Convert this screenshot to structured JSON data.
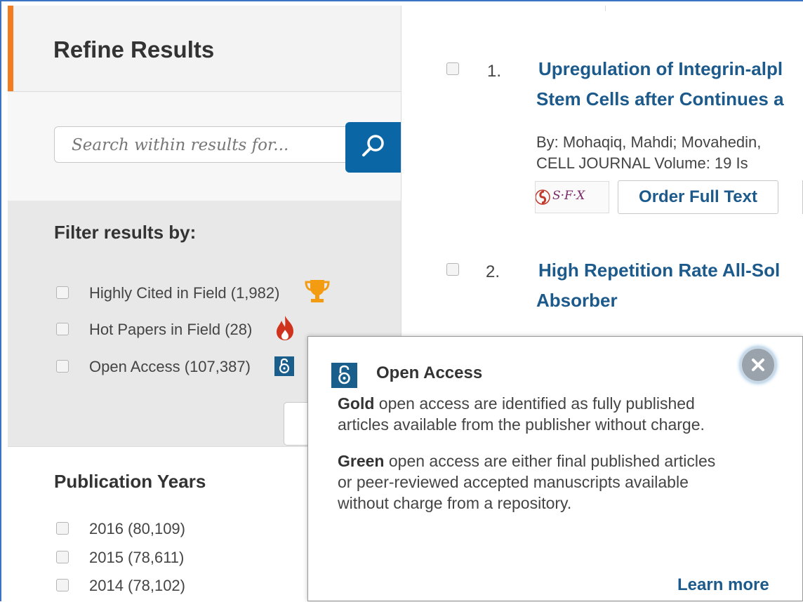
{
  "sidebar": {
    "title": "Refine Results",
    "search_placeholder": "Search within results for...",
    "filter_title": "Filter results by:",
    "filters": [
      {
        "label": "Highly Cited in Field (1,982)",
        "icon": "trophy-icon"
      },
      {
        "label": "Hot Papers in Field (28)",
        "icon": "flame-icon"
      },
      {
        "label": "Open Access (107,387)",
        "icon": "open-access-icon"
      }
    ],
    "years_title": "Publication Years",
    "years": [
      {
        "label": "2016 (80,109)"
      },
      {
        "label": "2015 (78,611)"
      },
      {
        "label": "2014 (78,102)"
      }
    ]
  },
  "results": [
    {
      "number": "1.",
      "title_line1": "Upregulation of Integrin-alpl",
      "title_line2": "Stem Cells after Continues a",
      "authors": "By: Mohaqiq, Mahdi; Movahedin,",
      "journal": "CELL JOURNAL  Volume: 19   Is",
      "order_label": "Order Full Text",
      "sfx_label": "S·F·X"
    },
    {
      "number": "2.",
      "title_line1": "High Repetition Rate All-Sol",
      "title_line2": "Absorber"
    }
  ],
  "popover": {
    "title": "Open Access",
    "gold_term": "Gold",
    "gold_text_1": " open access are identified as fully published",
    "gold_text_2": "articles available from the publisher without charge.",
    "green_term": "Green",
    "green_text_1": " open access are either final published articles",
    "green_text_2": "or peer-reviewed accepted manuscripts available",
    "green_text_3": "without charge from a repository.",
    "learn_more": "Learn more"
  },
  "colors": {
    "accent": "#f47c20",
    "link": "#1d5a8c",
    "search_button": "#0b66a6",
    "oa_badge": "#1a5f8c"
  }
}
